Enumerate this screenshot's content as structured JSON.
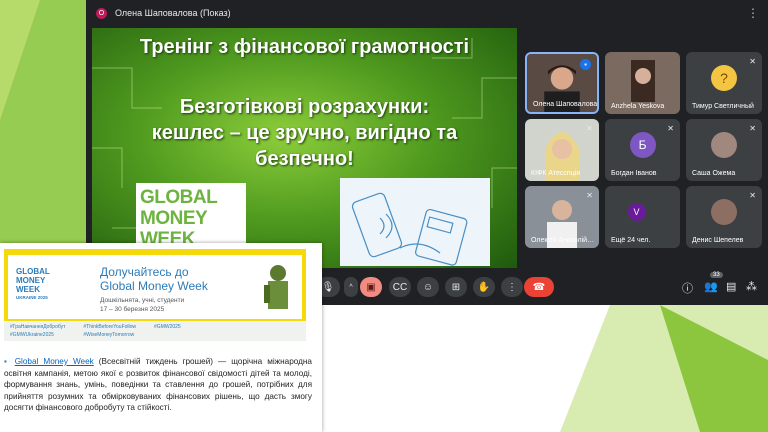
{
  "meet": {
    "presenter_badge": "О",
    "presenter_title": "Олена Шаповалова (Показ)",
    "more_icon": "more-vert-icon"
  },
  "slide": {
    "title": "Тренінг з фінансової грамотності",
    "subtitle_lines": [
      "Безготівкові розрахунки:",
      "кешлес – це зручно, вигідно та",
      "безпечно!"
    ],
    "logo_lines": [
      "GLOBAL",
      "MONEY",
      "WEEK"
    ]
  },
  "participants": [
    {
      "name": "Олена Шаповалова",
      "type": "video"
    },
    {
      "name": "Anzhela Yeskova",
      "type": "video"
    },
    {
      "name": "Тимур Светличный",
      "type": "avatar"
    },
    {
      "name": "КІФК Атесспція",
      "type": "video"
    },
    {
      "name": "Богдан Іванов",
      "type": "avatar",
      "initial": "Б"
    },
    {
      "name": "Саша Ожема",
      "type": "avatar"
    },
    {
      "name": "Олексій Анатолій…",
      "type": "video"
    },
    {
      "name": "Ещё 24 чел.",
      "type": "avatar",
      "initial": "V"
    },
    {
      "name": "Денис Шепелев",
      "type": "avatar"
    }
  ],
  "controls": {
    "participant_count": "33",
    "colors": {
      "leave": "#ea4335",
      "camera_off": "#f28b82",
      "meet_bg": "#202124"
    }
  },
  "overlay": {
    "banner_title_1": "Долучайтесь до",
    "banner_title_2": "Global Money Week",
    "banner_sub_1": "Дошкільнята, учні, студенти",
    "banner_sub_2": "17 – 30 березня 2025",
    "banner_logo": [
      "GLOBAL",
      "MONEY",
      "WEEK",
      "UKRAINE 2025"
    ],
    "hashtags": [
      "#ГраНавчанняДобробут",
      "#GMWUkraine2025",
      "#ThinkBeforeYouFollow",
      "#WiseMoneyTomorrow",
      "#GMW2025"
    ],
    "link_text": "Global Money Week",
    "paragraph": " (Всесвітній тиждень грошей) — щорічна міжнародна освітня кампанія, метою якої є розвиток фінансової свідомості дітей та молоді, формування знань, умінь, поведінки та ставлення до грошей, потрібних для прийняття розумних та обмірковуваних фінансових рішень, що дасть змогу досягти фінансового добробуту та стійкості."
  }
}
